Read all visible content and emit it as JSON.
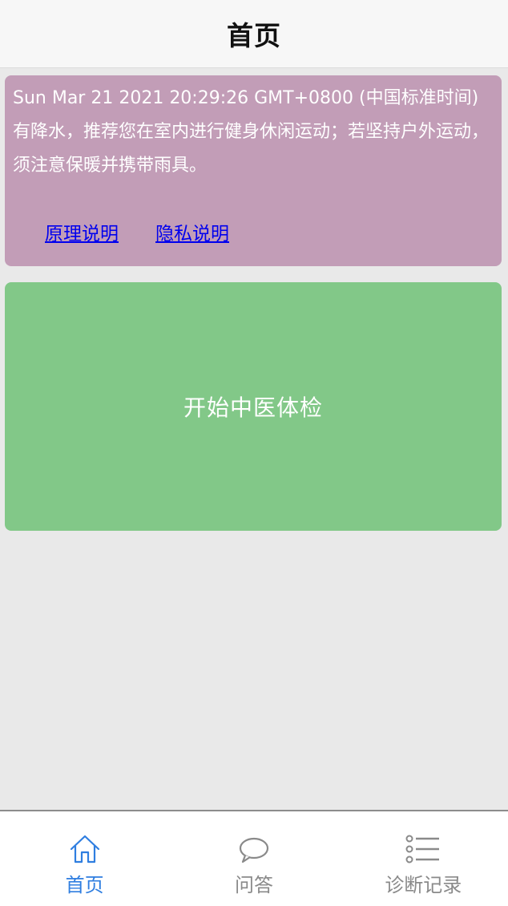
{
  "header": {
    "title": "首页"
  },
  "notice": {
    "text": "Sun Mar 21 2021 20:29:26 GMT+0800 (中国标准时间)有降水，推荐您在室内进行健身休闲运动；若坚持户外运动，须注意保暖并携带雨具。",
    "background_color": "#c29db7",
    "links": [
      {
        "label": "原理说明"
      },
      {
        "label": "隐私说明"
      }
    ]
  },
  "start_button": {
    "label": "开始中医体检",
    "background_color": "#82c888"
  },
  "tab_bar": {
    "active_color": "#2f7ee0",
    "inactive_color": "#8a8a8a",
    "tabs": [
      {
        "label": "首页",
        "icon": "home-icon",
        "active": true
      },
      {
        "label": "问答",
        "icon": "chat-bubble-icon",
        "active": false
      },
      {
        "label": "诊断记录",
        "icon": "list-icon",
        "active": false
      }
    ]
  }
}
